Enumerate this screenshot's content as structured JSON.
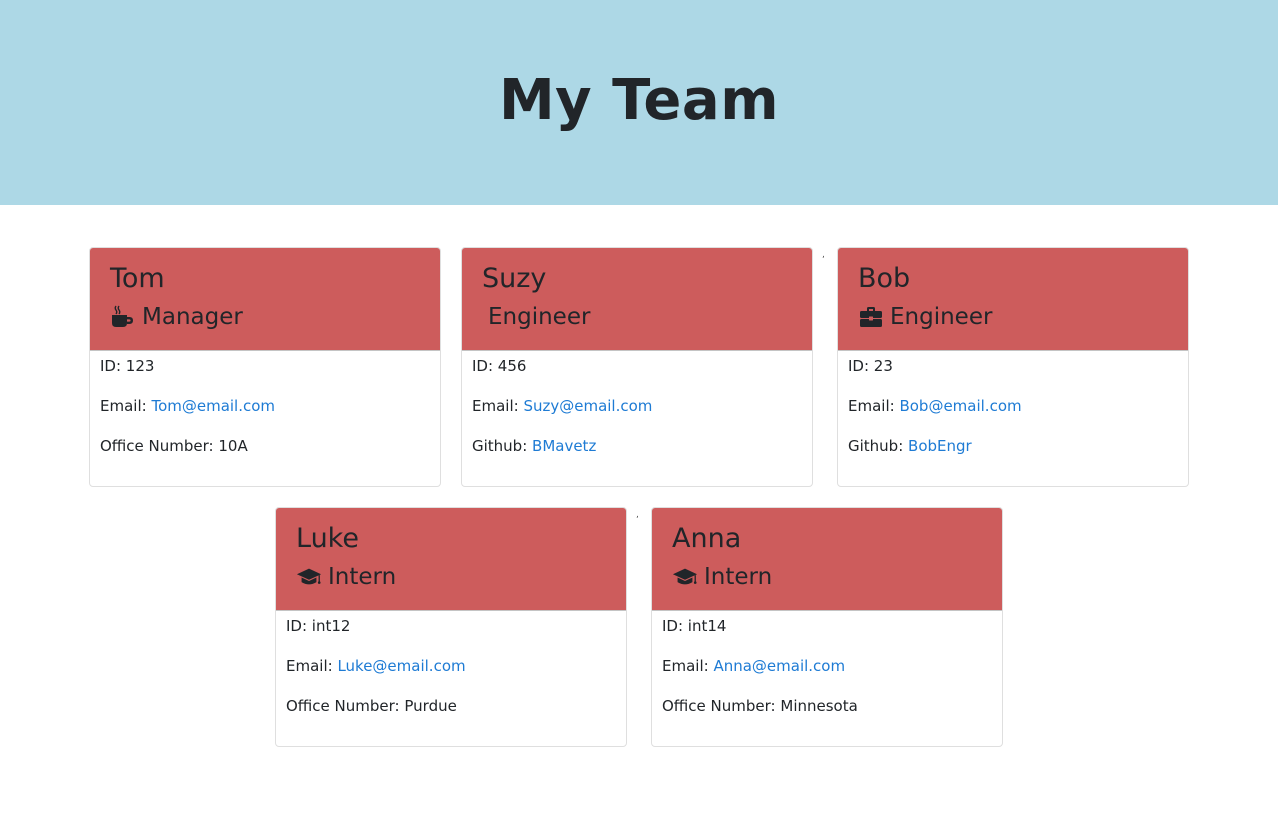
{
  "header": {
    "title": "My Team"
  },
  "labels": {
    "id": "ID: ",
    "email": "Email: ",
    "office": "Office Number: ",
    "github": "Github: "
  },
  "colors": {
    "jumbotron_bg": "#add8e6",
    "card_header_bg": "#cd5c5c",
    "link": "#1e7bd4"
  },
  "team": [
    {
      "name": "Tom",
      "role": "Manager",
      "icon": "mug-hot-icon",
      "id": "123",
      "email": "Tom@email.com",
      "extra_label": "Office Number: ",
      "extra_value": "10A"
    },
    {
      "name": "Suzy",
      "role": "Engineer",
      "icon": "",
      "id": "456",
      "email": "Suzy@email.com",
      "extra_label": "Github: ",
      "extra_value": "BMavetz"
    },
    {
      "name": "Bob",
      "role": "Engineer",
      "icon": "briefcase-icon",
      "id": "23",
      "email": "Bob@email.com",
      "extra_label": "Github: ",
      "extra_value": "BobEngr"
    },
    {
      "name": "Luke",
      "role": "Intern",
      "icon": "graduation-cap-icon",
      "id": "int12",
      "email": "Luke@email.com",
      "extra_label": "Office Number: ",
      "extra_value": "Purdue"
    },
    {
      "name": "Anna",
      "role": "Intern",
      "icon": "graduation-cap-icon",
      "id": "int14",
      "email": "Anna@email.com",
      "extra_label": "Office Number: ",
      "extra_value": "Minnesota"
    }
  ],
  "stray_marks": [
    ",",
    ","
  ]
}
